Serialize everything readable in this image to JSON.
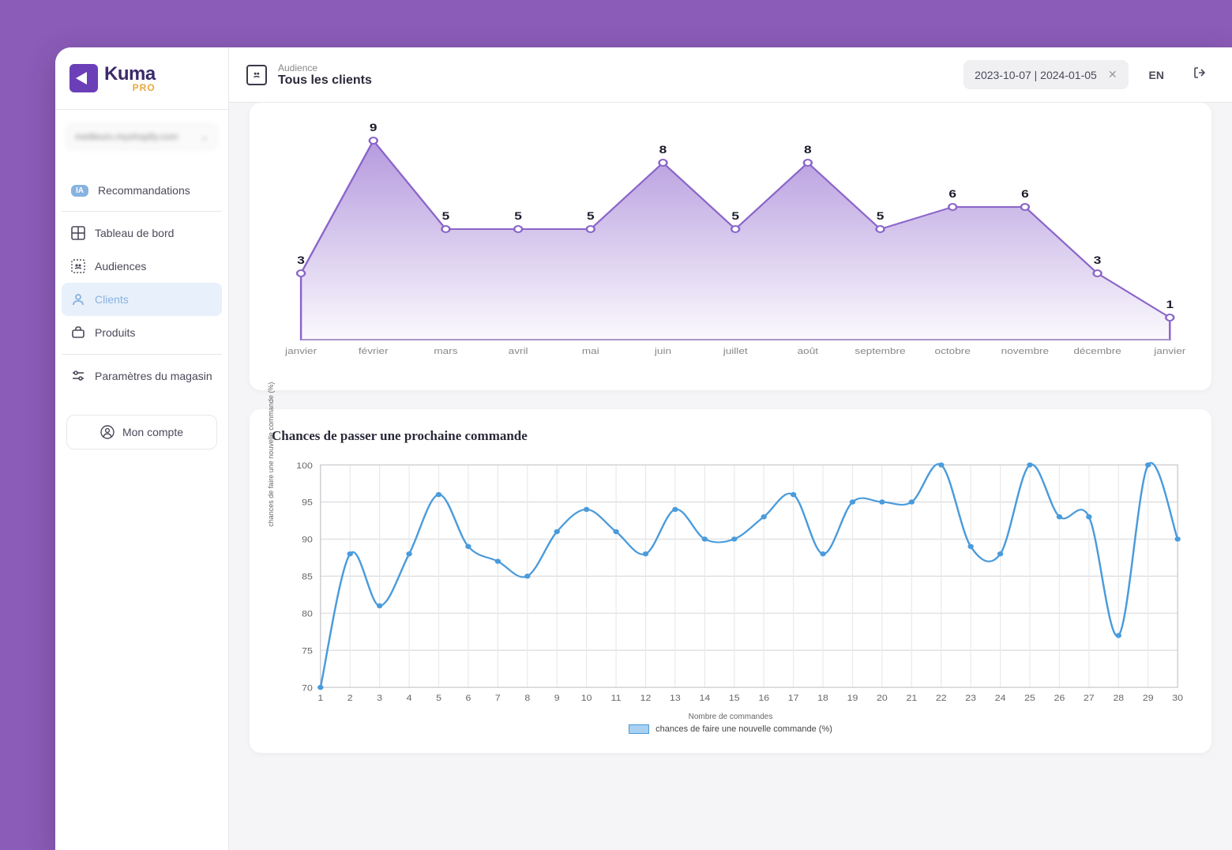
{
  "logo": {
    "name": "Kuma",
    "sub": "PRO"
  },
  "store_selector": {
    "value": "meilleurs.myshopify.com"
  },
  "nav": {
    "recommendations": {
      "badge": "IA",
      "label": "Recommandations"
    },
    "dashboard": "Tableau de bord",
    "audiences": "Audiences",
    "clients": "Clients",
    "products": "Produits",
    "settings": "Paramètres du magasin"
  },
  "account_button": "Mon compte",
  "topbar": {
    "crumb_label": "Audience",
    "crumb_value": "Tous les clients",
    "date_range": "2023-10-07 | 2024-01-05",
    "lang": "EN"
  },
  "chart_data": [
    {
      "type": "area",
      "categories": [
        "janvier",
        "février",
        "mars",
        "avril",
        "mai",
        "juin",
        "juillet",
        "août",
        "septembre",
        "octobre",
        "novembre",
        "décembre",
        "janvier"
      ],
      "values": [
        3,
        9,
        5,
        5,
        5,
        8,
        5,
        8,
        5,
        6,
        6,
        3,
        1
      ],
      "ylim": [
        0,
        10
      ]
    },
    {
      "type": "line",
      "title": "Chances de passer une prochaine commande",
      "xlabel": "Nombre de commandes",
      "ylabel": "chances de faire une nouvelle commande (%)",
      "legend": "chances de faire une nouvelle commande (%)",
      "x": [
        1,
        2,
        3,
        4,
        5,
        6,
        7,
        8,
        9,
        10,
        11,
        12,
        13,
        14,
        15,
        16,
        17,
        18,
        19,
        20,
        21,
        22,
        23,
        24,
        25,
        26,
        27,
        28,
        29,
        30
      ],
      "values": [
        70,
        88,
        81,
        88,
        96,
        89,
        87,
        85,
        91,
        94,
        91,
        88,
        94,
        90,
        90,
        93,
        96,
        88,
        95,
        95,
        95,
        100,
        89,
        88,
        100,
        93,
        93,
        77,
        100,
        90
      ],
      "ylim": [
        70,
        100
      ],
      "yticks": [
        70,
        75,
        80,
        85,
        90,
        95,
        100
      ]
    }
  ]
}
